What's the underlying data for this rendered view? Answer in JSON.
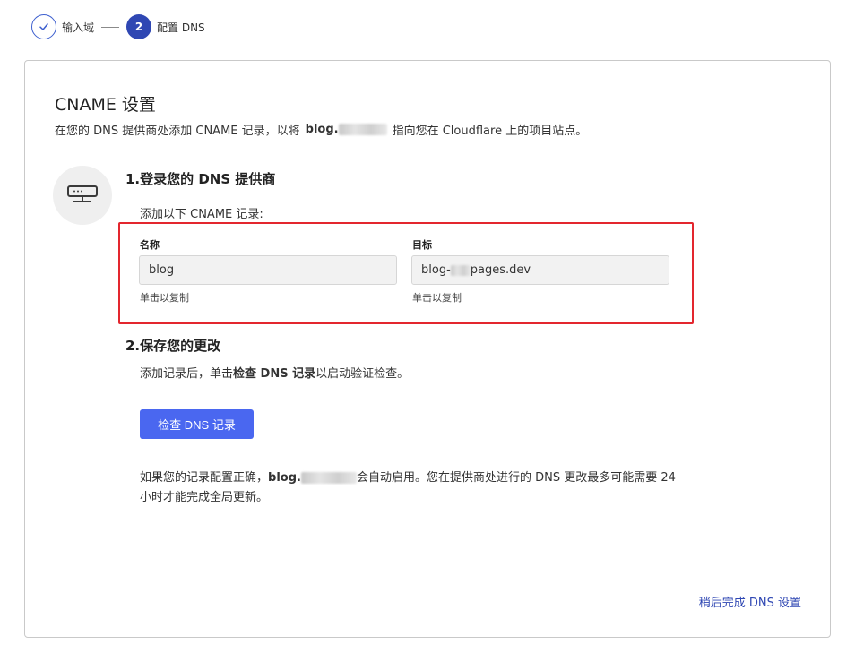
{
  "stepper": {
    "steps": [
      {
        "label": "输入域",
        "state": "done"
      },
      {
        "number": "2",
        "label": "配置 DNS",
        "state": "active"
      }
    ]
  },
  "card": {
    "title": "CNAME 设置",
    "desc_prefix": "在您的 DNS 提供商处添加 CNAME 记录，以将",
    "desc_domain": "blog.",
    "desc_suffix": "指向您在 Cloudflare 上的项目站点。",
    "icon": "server-icon"
  },
  "step1": {
    "heading": "1.登录您的 DNS 提供商",
    "instruction": "添加以下 CNAME 记录:",
    "name_label": "名称",
    "name_value": "blog",
    "name_hint": "单击以复制",
    "target_label": "目标",
    "target_prefix": "blog-",
    "target_suffix": "pages.dev",
    "target_hint": "单击以复制"
  },
  "step2": {
    "heading": "2.保存您的更改",
    "instruction_prefix": "添加记录后，单击",
    "instruction_bold": "检查 DNS 记录",
    "instruction_suffix": "以启动验证检查。",
    "button_label": "检查 DNS 记录"
  },
  "note": {
    "prefix": "如果您的记录配置正确，",
    "domain": "blog.",
    "suffix": "会自动启用。您在提供商处进行的 DNS 更改最多可能需要 24 小时才能完成全局更新。"
  },
  "footer": {
    "later_link": "稍后完成 DNS 设置"
  },
  "colors": {
    "accent": "#4a67f0",
    "link": "#2f47b3",
    "highlight": "#e3262e"
  }
}
